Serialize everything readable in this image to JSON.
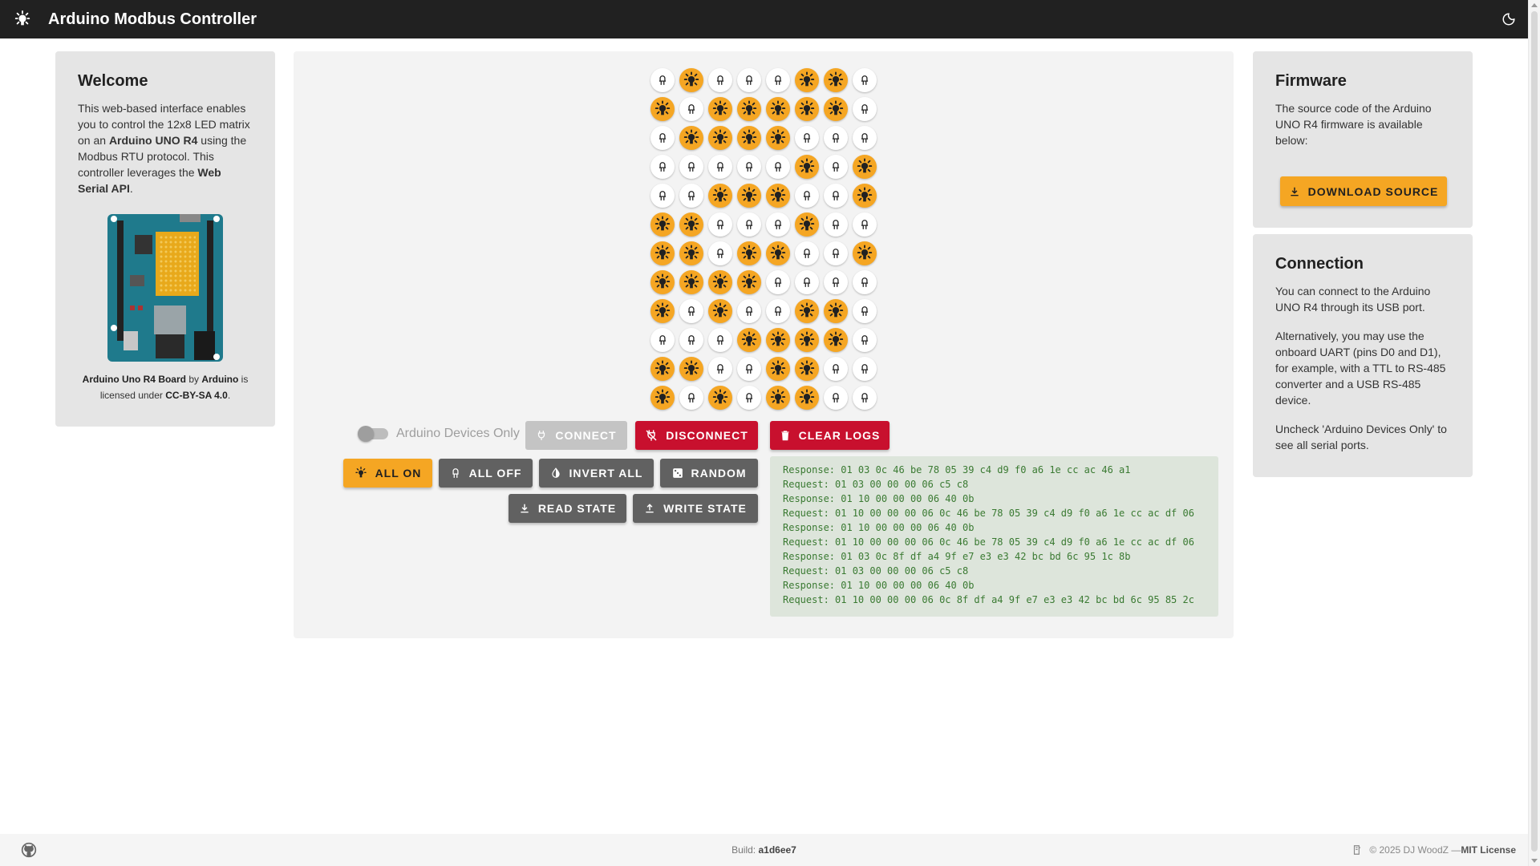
{
  "app": {
    "title": "Arduino Modbus Controller",
    "logo_icon": "led-on-icon",
    "theme_icon": "theme-toggle-moon-icon"
  },
  "welcome": {
    "title": "Welcome",
    "text_1": "This web-based interface enables you to control the 12x8 LED matrix on an ",
    "text_board": "Arduino UNO R4",
    "text_2": " using the Modbus RTU protocol. This controller leverages the ",
    "text_api": "Web Serial API",
    "text_3": ".",
    "credit_title": "Arduino Uno R4 Board",
    "credit_by": " by ",
    "credit_author": "Arduino",
    "credit_is": " is licensed under ",
    "credit_license": "CC-BY-SA 4.0",
    "credit_end": "."
  },
  "firmware": {
    "title": "Firmware",
    "text": "The source code of the Arduino UNO R4 firmware is available below:",
    "download_label": "DOWNLOAD SOURCE"
  },
  "connection": {
    "title": "Connection",
    "p1": "You can connect to the Arduino UNO R4 through its USB port.",
    "p2": "Alternatively, you may use the onboard UART (pins D0 and D1), for example, with a TTL to RS-485 converter and a USB RS-485 device.",
    "p3": "Uncheck 'Arduino Devices Only' to see all serial ports."
  },
  "controls": {
    "arduino_only_label": "Arduino Devices Only",
    "arduino_only_checked": false,
    "connect_label": "CONNECT",
    "disconnect_label": "DISCONNECT",
    "clear_logs_label": "CLEAR LOGS",
    "all_on_label": "ALL ON",
    "all_off_label": "ALL OFF",
    "invert_label": "INVERT ALL",
    "random_label": "RANDOM",
    "read_label": "READ STATE",
    "write_label": "WRITE STATE"
  },
  "matrix": {
    "rows": [
      [
        0,
        1,
        0,
        0,
        0,
        1,
        1,
        0
      ],
      [
        1,
        0,
        1,
        1,
        1,
        1,
        1,
        0
      ],
      [
        0,
        1,
        1,
        1,
        1,
        0,
        0,
        0
      ],
      [
        0,
        0,
        0,
        0,
        0,
        1,
        0,
        1
      ],
      [
        0,
        0,
        1,
        1,
        1,
        0,
        0,
        1
      ],
      [
        1,
        1,
        0,
        0,
        0,
        1,
        0,
        0
      ],
      [
        1,
        1,
        0,
        1,
        1,
        0,
        0,
        1
      ],
      [
        1,
        1,
        1,
        1,
        0,
        0,
        0,
        0
      ],
      [
        1,
        0,
        1,
        0,
        0,
        1,
        1,
        0
      ],
      [
        0,
        0,
        0,
        1,
        1,
        1,
        1,
        0
      ],
      [
        1,
        1,
        0,
        0,
        1,
        1,
        0,
        0
      ],
      [
        1,
        0,
        1,
        0,
        1,
        1,
        0,
        0
      ]
    ]
  },
  "logs": [
    "Response: 01 03 0c 46 be 78 05 39 c4 d9 f0 a6 1e cc ac 46 a1",
    "Request: 01 03 00 00 00 06 c5 c8",
    "Response: 01 10 00 00 00 06 40 0b",
    "Request: 01 10 00 00 00 06 0c 46 be 78 05 39 c4 d9 f0 a6 1e cc ac df 06",
    "Response: 01 10 00 00 00 06 40 0b",
    "Request: 01 10 00 00 00 06 0c 46 be 78 05 39 c4 d9 f0 a6 1e cc ac df 06",
    "Response: 01 03 0c 8f df a4 9f e7 e3 e3 42 bc bd 6c 95 1c 8b",
    "Request: 01 03 00 00 00 06 c5 c8",
    "Response: 01 10 00 00 00 06 40 0b",
    "Request: 01 10 00 00 00 06 0c 8f df a4 9f e7 e3 e3 42 bc bd 6c 95 85 2c"
  ],
  "footer": {
    "build_label": "Build: ",
    "build_hash": "a1d6ee7",
    "copyright": "© 2025 DJ WoodZ — ",
    "license": "MIT License",
    "github_icon": "github-icon",
    "license_icon": "license-icon"
  },
  "colors": {
    "appbar": "#212121",
    "led_on": "#f5a623",
    "led_off": "#ffffff",
    "danger": "#c8102e",
    "button_grey": "#616161",
    "log_text": "#3a7a32",
    "log_bg": "#dde5db"
  }
}
